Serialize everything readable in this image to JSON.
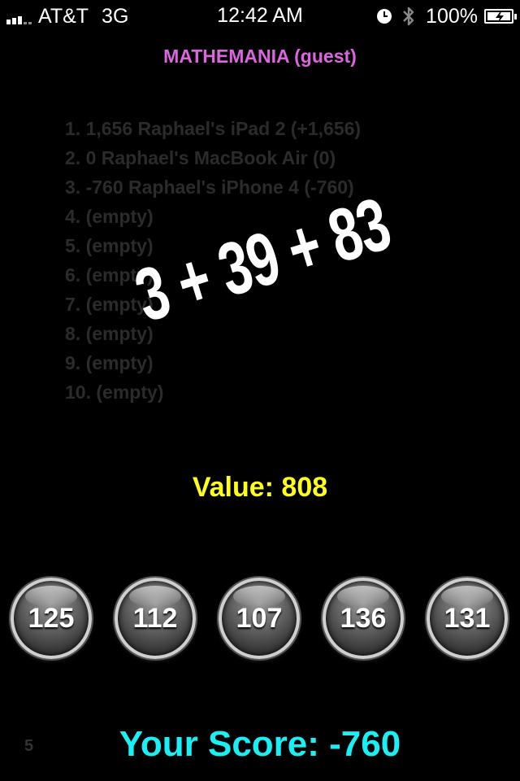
{
  "status_bar": {
    "carrier": "AT&T",
    "network": "3G",
    "time": "12:42 AM",
    "battery_percent": "100%",
    "battery_level": 1.0,
    "icons": [
      "signal-icon",
      "clock-icon",
      "bluetooth-icon",
      "battery-icon"
    ]
  },
  "app": {
    "title": "MATHEMANIA (guest)"
  },
  "leaderboard": [
    "1. 1,656 Raphael's iPad 2 (+1,656)",
    "2. 0 Raphael's MacBook Air (0)",
    "3. -760 Raphael's iPhone 4 (-760)",
    "4. (empty)",
    "5. (empty)",
    "6. (empty)",
    "7. (empty)",
    "8. (empty)",
    "9. (empty)",
    "10. (empty)"
  ],
  "equation": "3 + 39 + 83",
  "value_line": "Value: 808",
  "answers": [
    "125",
    "112",
    "107",
    "136",
    "131"
  ],
  "footer": {
    "round_number": "5",
    "score_line": "Your Score: -760"
  },
  "colors": {
    "title": "#dd66e0",
    "value": "#ffff1a",
    "score": "#19f0f5",
    "leaderboard_text": "#2b2b2b",
    "background": "#000000"
  }
}
